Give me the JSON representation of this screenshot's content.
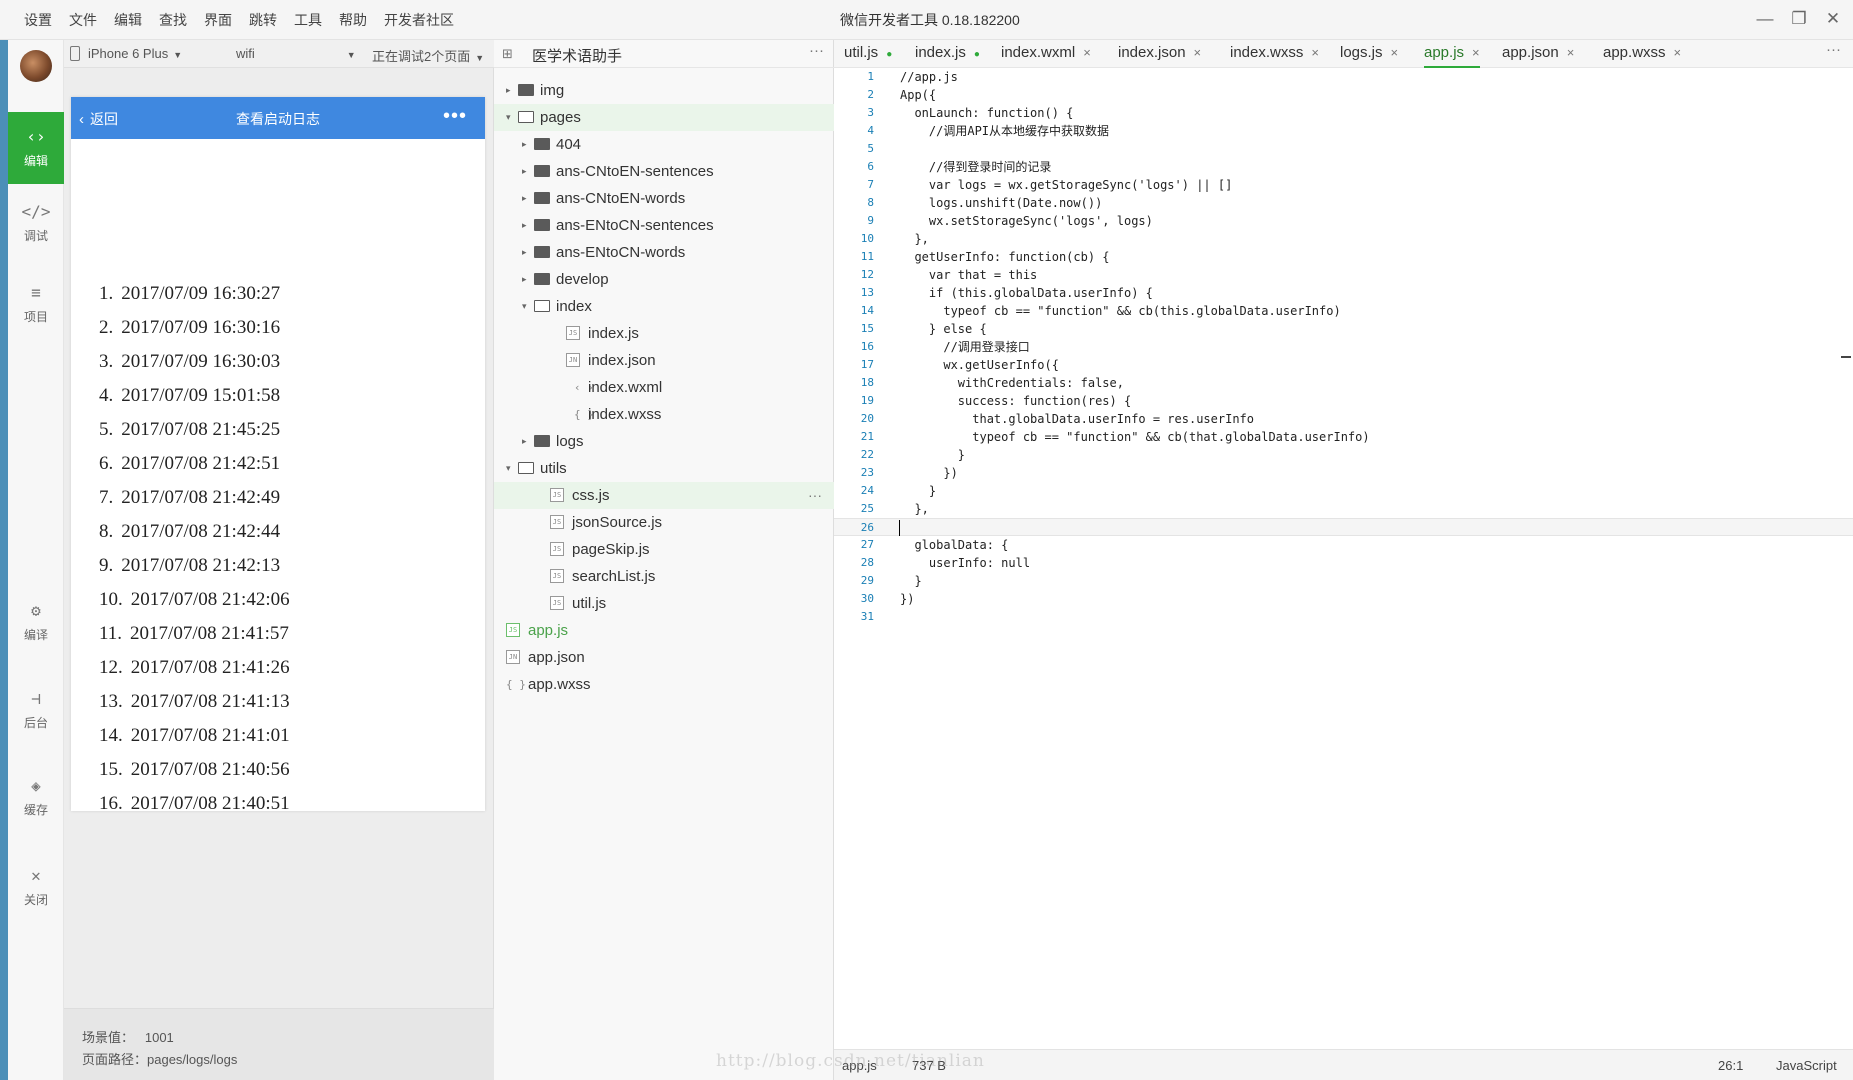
{
  "menu": [
    "设置",
    "文件",
    "编辑",
    "查找",
    "界面",
    "跳转",
    "工具",
    "帮助",
    "开发者社区"
  ],
  "window": {
    "title": "微信开发者工具 0.18.182200",
    "min": "—",
    "max": "❐",
    "close": "✕"
  },
  "activity": [
    {
      "name": "edit",
      "label": "编辑",
      "icon": "‹›"
    },
    {
      "name": "debug",
      "label": "调试",
      "icon": "</>"
    },
    {
      "name": "project",
      "label": "项目",
      "icon": "≡"
    },
    {
      "name": "compile",
      "label": "编译",
      "icon": "⚙"
    },
    {
      "name": "background",
      "label": "后台",
      "icon": "⊣"
    },
    {
      "name": "cache",
      "label": "缓存",
      "icon": "◈"
    },
    {
      "name": "close",
      "label": "关闭",
      "icon": "✕"
    }
  ],
  "simulator": {
    "device": "iPhone 6 Plus",
    "network": "wifi",
    "debug": "正在调试2个页面",
    "nav": {
      "back": "返回",
      "title": "查看启动日志",
      "more": "•••"
    },
    "logs": [
      "2017/07/09 16:30:27",
      "2017/07/09 16:30:16",
      "2017/07/09 16:30:03",
      "2017/07/09 15:01:58",
      "2017/07/08 21:45:25",
      "2017/07/08 21:42:51",
      "2017/07/08 21:42:49",
      "2017/07/08 21:42:44",
      "2017/07/08 21:42:13",
      "2017/07/08 21:42:06",
      "2017/07/08 21:41:57",
      "2017/07/08 21:41:26",
      "2017/07/08 21:41:13",
      "2017/07/08 21:41:01",
      "2017/07/08 21:40:56",
      "2017/07/08 21:40:51"
    ],
    "footer": {
      "scene_label": "场景值：",
      "scene_value": "1001",
      "path_label": "页面路径：",
      "path_value": "pages/logs/logs"
    }
  },
  "explorer": {
    "project": "医学术语助手",
    "rows": [
      {
        "label": "img",
        "depth": 0,
        "type": "folder",
        "arrow": "▸"
      },
      {
        "label": "pages",
        "depth": 0,
        "type": "folder-open",
        "arrow": "▾",
        "hl": true
      },
      {
        "label": "404",
        "depth": 1,
        "type": "folder",
        "arrow": "▸"
      },
      {
        "label": "ans-CNtoEN-sentences",
        "depth": 1,
        "type": "folder",
        "arrow": "▸"
      },
      {
        "label": "ans-CNtoEN-words",
        "depth": 1,
        "type": "folder",
        "arrow": "▸"
      },
      {
        "label": "ans-ENtoCN-sentences",
        "depth": 1,
        "type": "folder",
        "arrow": "▸"
      },
      {
        "label": "ans-ENtoCN-words",
        "depth": 1,
        "type": "folder",
        "arrow": "▸"
      },
      {
        "label": "develop",
        "depth": 1,
        "type": "folder",
        "arrow": "▸"
      },
      {
        "label": "index",
        "depth": 1,
        "type": "folder-open",
        "arrow": "▾"
      },
      {
        "label": "index.js",
        "depth": 2,
        "type": "js"
      },
      {
        "label": "index.json",
        "depth": 2,
        "type": "json"
      },
      {
        "label": "index.wxml",
        "depth": 2,
        "type": "wxml"
      },
      {
        "label": "index.wxss",
        "depth": 2,
        "type": "wxss"
      },
      {
        "label": "logs",
        "depth": 1,
        "type": "folder",
        "arrow": "▸"
      },
      {
        "label": "utils",
        "depth": 0,
        "type": "folder-open",
        "arrow": "▾"
      },
      {
        "label": "css.js",
        "depth": 1,
        "type": "js",
        "hl": true,
        "dots": "···"
      },
      {
        "label": "jsonSource.js",
        "depth": 1,
        "type": "js"
      },
      {
        "label": "pageSkip.js",
        "depth": 1,
        "type": "js"
      },
      {
        "label": "searchList.js",
        "depth": 1,
        "type": "js"
      },
      {
        "label": "util.js",
        "depth": 1,
        "type": "js"
      },
      {
        "label": "app.js",
        "depth": 0,
        "type": "js",
        "green": true
      },
      {
        "label": "app.json",
        "depth": 0,
        "type": "json"
      },
      {
        "label": "app.wxss",
        "depth": 0,
        "type": "wxss"
      }
    ]
  },
  "tabs": [
    {
      "label": "util.js",
      "mark": "●"
    },
    {
      "label": "index.js",
      "mark": "●"
    },
    {
      "label": "index.wxml",
      "mark": "×"
    },
    {
      "label": "index.json",
      "mark": "×"
    },
    {
      "label": "index.wxss",
      "mark": "×"
    },
    {
      "label": "logs.js",
      "mark": "×"
    },
    {
      "label": "app.js",
      "mark": "×",
      "active": true
    },
    {
      "label": "app.json",
      "mark": "×"
    },
    {
      "label": "app.wxss",
      "mark": "×"
    }
  ],
  "code": [
    "//app.js",
    "App({",
    "  onLaunch: function() {",
    "    //调用API从本地缓存中获取数据",
    "",
    "    //得到登录时间的记录",
    "    var logs = wx.getStorageSync('logs') || []",
    "    logs.unshift(Date.now())",
    "    wx.setStorageSync('logs', logs)",
    "  },",
    "  getUserInfo: function(cb) {",
    "    var that = this",
    "    if (this.globalData.userInfo) {",
    "      typeof cb == \"function\" && cb(this.globalData.userInfo)",
    "    } else {",
    "      //调用登录接口",
    "      wx.getUserInfo({",
    "        withCredentials: false,",
    "        success: function(res) {",
    "          that.globalData.userInfo = res.userInfo",
    "          typeof cb == \"function\" && cb(that.globalData.userInfo)",
    "        }",
    "      })",
    "    }",
    "  },",
    "",
    "  globalData: {",
    "    userInfo: null",
    "  }",
    "})",
    ""
  ],
  "cursor_line": 26,
  "status": {
    "file": "app.js",
    "size": "737 B",
    "position": "26:1",
    "language": "JavaScript"
  },
  "watermark": "http://blog.csdn.net/tianlian"
}
